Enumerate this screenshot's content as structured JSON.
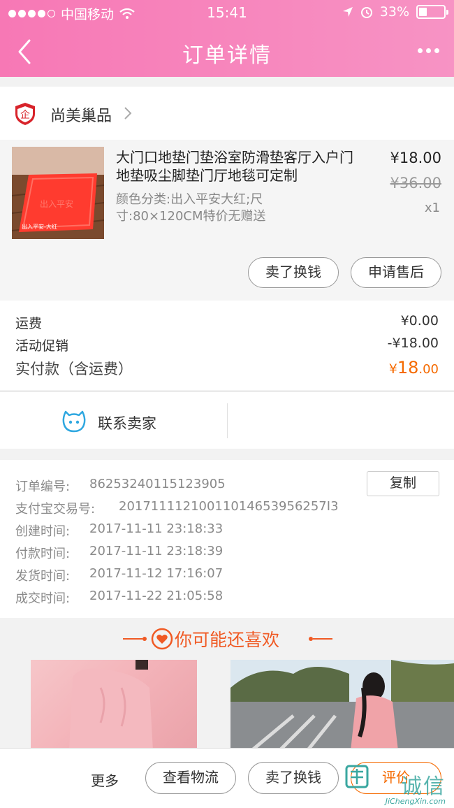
{
  "status_bar": {
    "carrier": "中国移动",
    "time": "15:41",
    "battery": "33%"
  },
  "nav": {
    "title": "订单详情"
  },
  "shop": {
    "name": "尚美巢品"
  },
  "product": {
    "title": "大门口地垫门垫浴室防滑垫客厅入户门地垫吸尘脚垫门厅地毯可定制",
    "spec": "颜色分类:出入平安大红;尺寸:80×120CM特价无赠送",
    "thumb_caption": "出入平安-大红",
    "price": "¥18.00",
    "original_price": "¥36.00",
    "quantity": "x1",
    "sell_button": "卖了换钱",
    "after_sale_button": "申请售后"
  },
  "fees": {
    "shipping_label": "运费",
    "shipping_value": "¥0.00",
    "promo_label": "活动促销",
    "promo_value": "-¥18.00",
    "total_label": "实付款（含运费）",
    "total_currency": "¥",
    "total_int": "18",
    "total_dec": ".00"
  },
  "contact": {
    "label": "联系卖家"
  },
  "order_info": {
    "copy_button": "复制",
    "rows": [
      {
        "label": "订单编号:",
        "value": "86253240115123905"
      },
      {
        "label": "支付宝交易号:",
        "value": "20171111210011014653956257I3"
      },
      {
        "label": "创建时间:",
        "value": "2017-11-11 23:18:33"
      },
      {
        "label": "付款时间:",
        "value": "2017-11-11 23:18:39"
      },
      {
        "label": "发货时间:",
        "value": "2017-11-12 17:16:07"
      },
      {
        "label": "成交时间:",
        "value": "2017-11-22 21:05:58"
      }
    ]
  },
  "recommend": {
    "title": "你可能还喜欢"
  },
  "bottom_bar": {
    "more": "更多",
    "logistics": "查看物流",
    "sell": "卖了换钱",
    "review": "评价"
  },
  "watermark": {
    "text": "诚信",
    "sub": "JiChengXin.com"
  },
  "colors": {
    "header_pink": "#f778b5",
    "accent_orange": "#f56a00",
    "recommend_orange": "#f05a24",
    "contact_blue": "#2ea7e0"
  }
}
